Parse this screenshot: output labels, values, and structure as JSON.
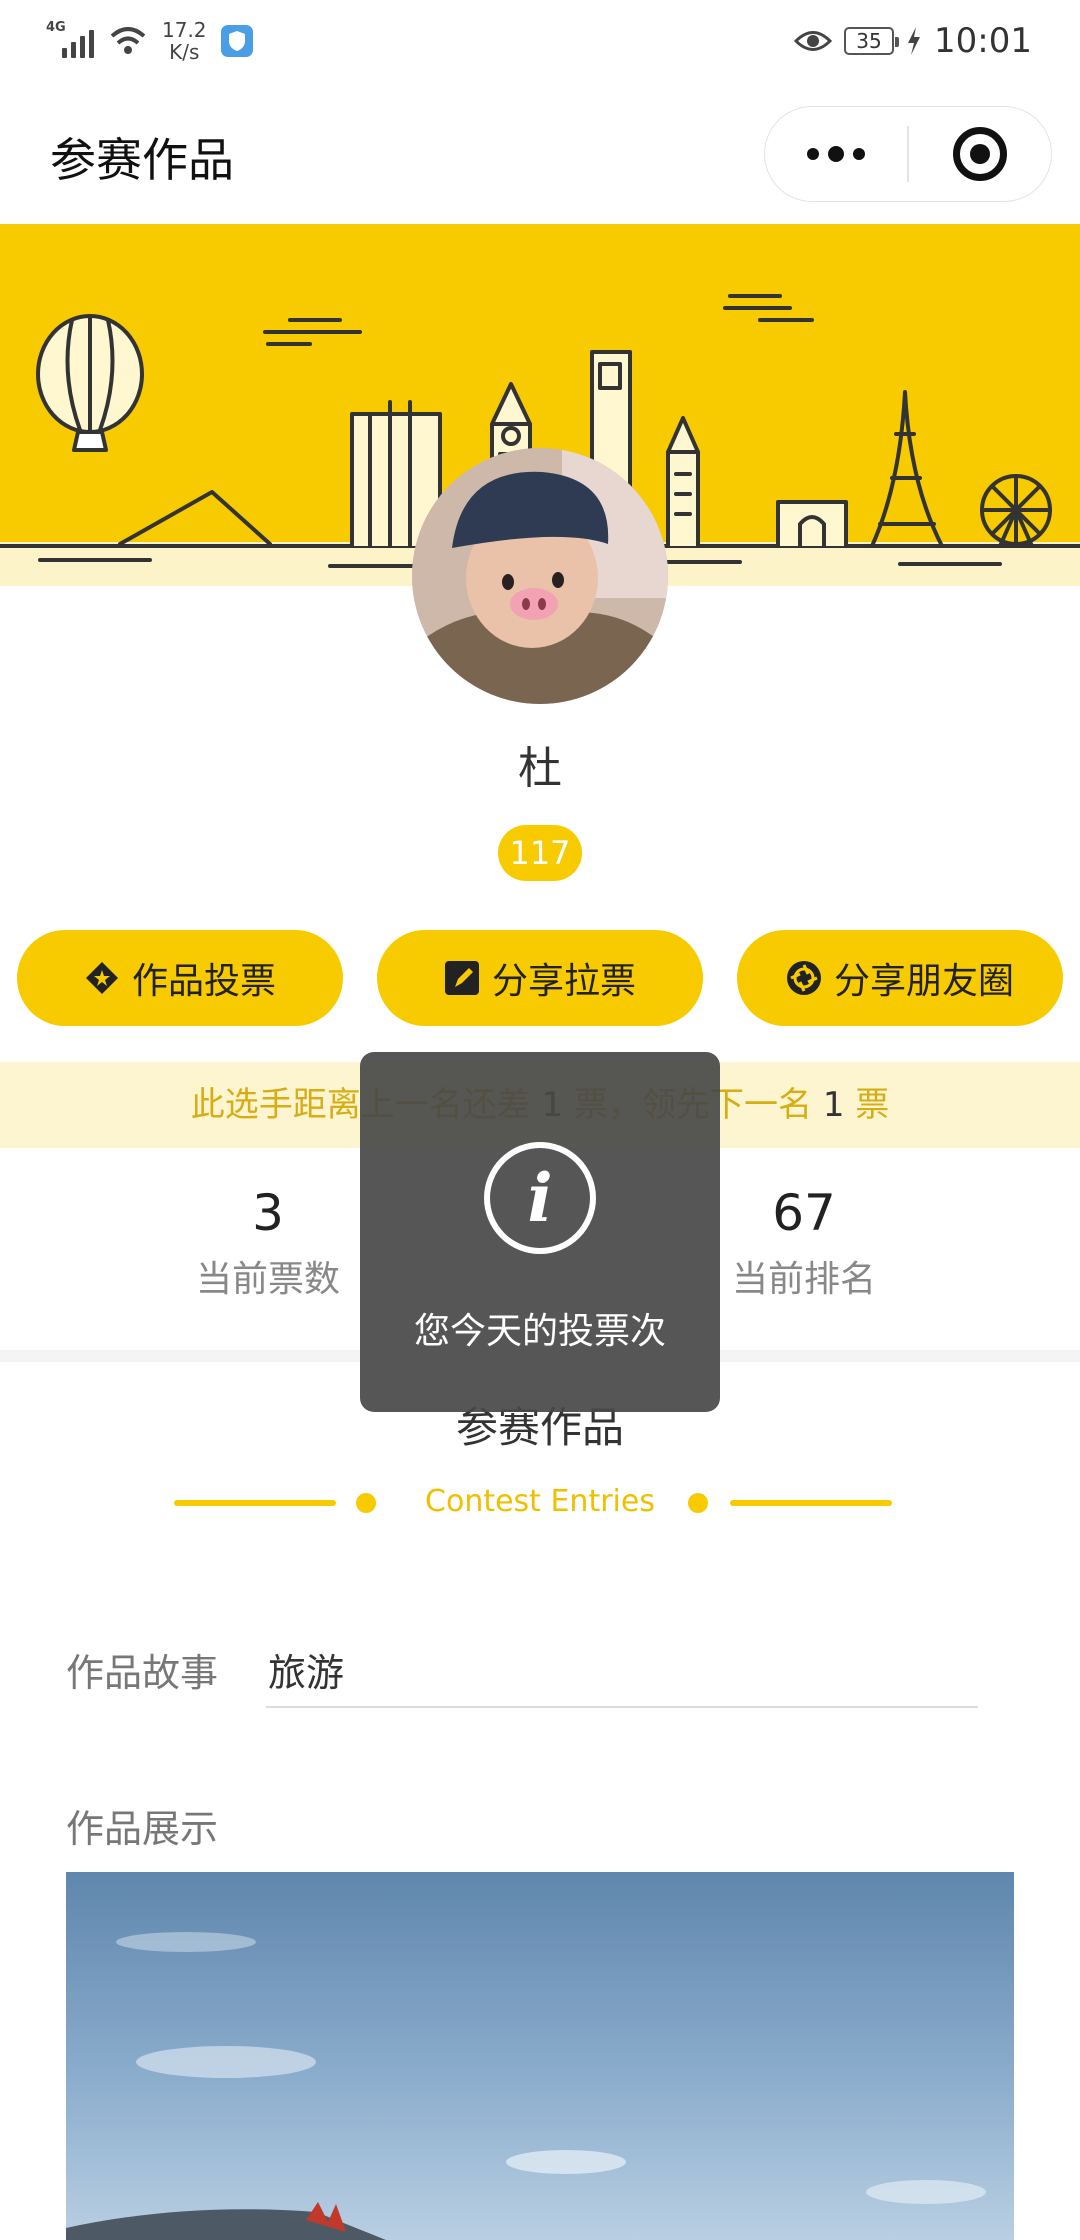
{
  "status_bar": {
    "network": "4G",
    "speed_value": "17.2",
    "speed_unit": "K/s",
    "battery": "35",
    "time": "10:01"
  },
  "nav": {
    "title": "参赛作品",
    "more_icon": "more-dots-icon",
    "close_icon": "target-circle-icon"
  },
  "profile": {
    "name": "杜",
    "votes_badge": "117"
  },
  "actions": [
    {
      "label": "作品投票",
      "icon": "vote-icon"
    },
    {
      "label": "分享拉票",
      "icon": "edit-share-icon"
    },
    {
      "label": "分享朋友圈",
      "icon": "camera-shutter-icon"
    }
  ],
  "gap_notice": {
    "part1": "此选手距离上一名还差 ",
    "behind": "1",
    "part2": " 票，领先下一名 ",
    "ahead": "1",
    "part3": " 票"
  },
  "stats": {
    "current_votes_value": "3",
    "current_votes_label": "当前票数",
    "rank_value": "67",
    "rank_label": "当前排名"
  },
  "section": {
    "title": "参赛作品",
    "subtitle": "Contest Entries"
  },
  "story": {
    "label": "作品故事",
    "value": "旅游"
  },
  "showcase": {
    "label": "作品展示"
  },
  "toast": {
    "icon": "info-icon",
    "text": "您今天的投票次"
  },
  "colors": {
    "accent": "#f7cb00",
    "notice_bg": "#fdf5cf",
    "notice_text": "#d6ad14"
  }
}
